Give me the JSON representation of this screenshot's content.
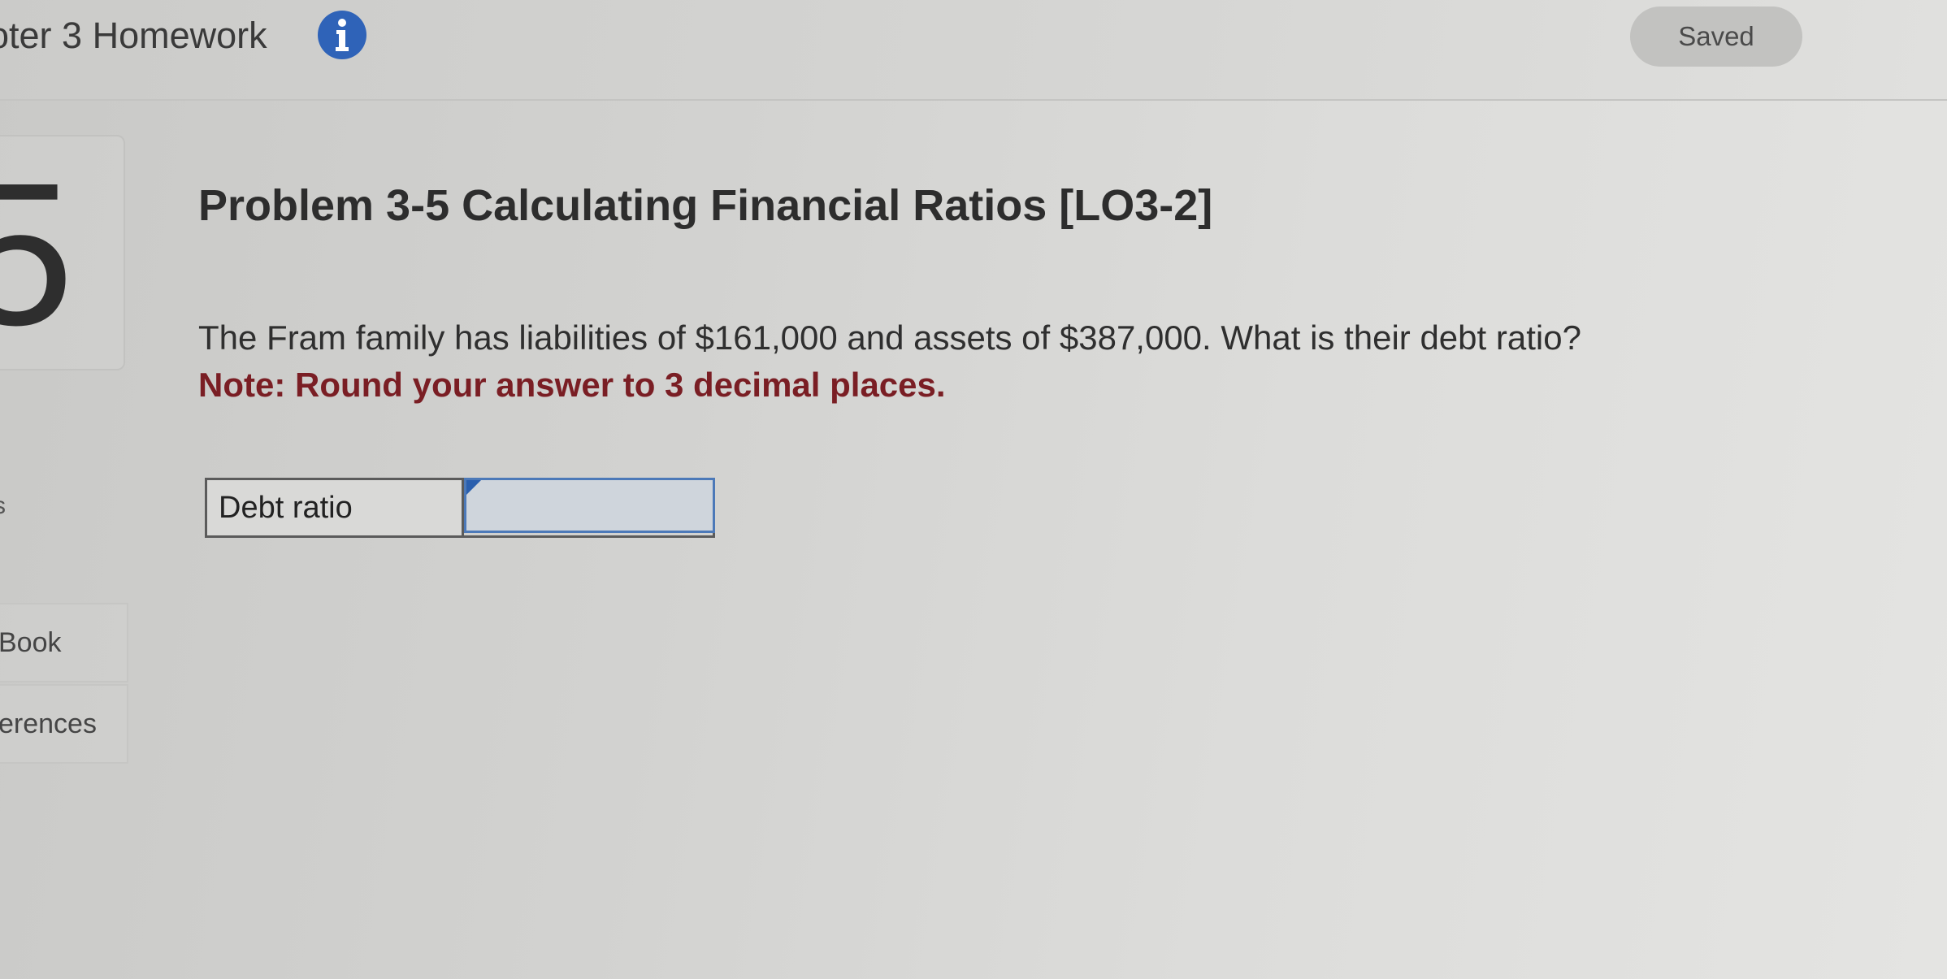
{
  "header": {
    "assignment_title": "oter 3 Homework",
    "info_icon": "info-icon",
    "status": "Saved"
  },
  "sidebar": {
    "question_number": "5",
    "points_fragment": "s",
    "links": [
      {
        "label": "Book"
      },
      {
        "label": "erences"
      }
    ]
  },
  "problem": {
    "title": "Problem 3-5 Calculating Financial Ratios [LO3-2]",
    "text": "The Fram family has liabilities of $161,000 and assets of $387,000. What is their debt ratio?",
    "note": "Note: Round your answer to 3 decimal places.",
    "answer_row": {
      "label": "Debt ratio",
      "value": ""
    }
  },
  "colors": {
    "note_text": "#7a1e24",
    "info_icon_bg": "#2f63b8",
    "input_border": "#4c79b8"
  }
}
